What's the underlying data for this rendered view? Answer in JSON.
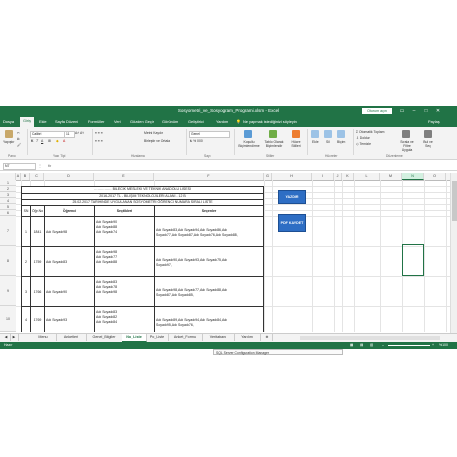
{
  "window": {
    "title": "Sosyometri_ve_Sosyogram_Programi.xlsm - Excel",
    "sign_in": "Oturum açın"
  },
  "menu": {
    "items": [
      "Dosya",
      "Giriş",
      "Ekle",
      "Sayfa Düzeni",
      "Formüller",
      "Veri",
      "Gözden Geçir",
      "Görünüm",
      "Geliştirici",
      "Yardım"
    ],
    "tell_me": "Ne yapmak istediğinizi söyleyin",
    "share": "Paylaş"
  },
  "ribbon": {
    "paste": "Yapıştır",
    "font_name": "Calibri",
    "font_size": "11",
    "wrap_text": "Metni Kaydır",
    "merge_center": "Birleştir ve Ortala",
    "number_format": "Genel",
    "cond_format": "Koşullu Biçimlendirme",
    "format_table": "Tablo Olarak Biçimlendir",
    "cell_styles": "Hücre Stilleri",
    "insert": "Ekle",
    "delete": "Sil",
    "format": "Biçim",
    "autosum": "Otomatik Toplam",
    "fill": "Doldur",
    "clear": "Temizle",
    "sort_filter": "Sırala ve Filtre Uygula",
    "find_select": "Bul ve Seç",
    "groups": [
      "Pano",
      "Yazı Tipi",
      "Hizalama",
      "Sayı",
      "Stiller",
      "Hücreler",
      "Düzenleme"
    ]
  },
  "formula_bar": {
    "name_box": "N7",
    "fx": "fx",
    "value": ""
  },
  "columns": [
    "A",
    "B",
    "C",
    "D",
    "E",
    "F",
    "G",
    "H",
    "I",
    "J",
    "K",
    "L",
    "M",
    "N",
    "O"
  ],
  "rows": [
    "1",
    "2",
    "3",
    "4",
    "5",
    "6",
    "7",
    "8",
    "9",
    "10"
  ],
  "sheet": {
    "school": "…………… BİLECİK MESLEKİ VE TEKNİK ANADOLU LİSESİ",
    "class_line": "2016-2017   TL - BİLİŞİM TEKNOLOJİLERİ ALANI - 12 B",
    "date_line": "25.02.2017    TARİHİNDE UYGULANAN SOSYOMETRİ ÖĞRENCİ NUMARA SIRALI LİSTE",
    "headers": {
      "sn": "SN",
      "no": "Öğr.No",
      "student": "Öğrenci",
      "chosen": "Seçtikleri",
      "choosers": "Seçenler"
    },
    "records": [
      {
        "sn": "1",
        "no": "1841",
        "student": "Adı Soyadı98",
        "chosen": [
          "Adı Soyadı90",
          "Adı Soyadı88",
          "Adı Soyadı74"
        ],
        "choosers": [
          "Adı Soyadı83,Adı Soyadı94,Adı Soyadı86,Adı",
          "Soyadı77,Adı Soyadı87,Adı Soyadı76,Adı Soyadı88,"
        ]
      },
      {
        "sn": "2",
        "no": "1759",
        "student": "Adı Soyadı83",
        "chosen": [
          "Adı Soyadı98",
          "Adı Soyadı77",
          "Adı Soyadı88"
        ],
        "choosers": [
          "Adı Soyadı90,Adı Soyadı93,Adı Soyadı75,Adı",
          "Soyadı97,"
        ]
      },
      {
        "sn": "3",
        "no": "1766",
        "student": "Adı Soyadı90",
        "chosen": [
          "Adı Soyadı83",
          "Adı Soyadı78",
          "Adı Soyadı98"
        ],
        "choosers": [
          "Adı Soyadı98,Adı Soyadı77,Adı Soyadı88,Adı",
          "Soyadı87,Adı Soyadı85,"
        ]
      },
      {
        "sn": "4",
        "no": "1769",
        "student": "Adı Soyadı93",
        "chosen": [
          "Adı Soyadı83",
          "Adı Soyadı82",
          "Adı Soyadı84"
        ],
        "choosers": [
          "Adı Soyadı89,Adı Soyadı94,Adı Soyadı84,Adı",
          "Soyadı95,Adı Soyadı76,"
        ]
      }
    ],
    "print_button": "YAZDIR",
    "pdf_button": "PDF KAYDET"
  },
  "tabs": [
    "Menu",
    "Anketleri",
    "Genel_Bilgiler",
    "No_Liste",
    "Po_Liste",
    "Anket_Formu",
    "Veritabanı",
    "Yardım"
  ],
  "active_tab": "No_Liste",
  "status": {
    "mode": "Hazır",
    "zoom": "%100"
  },
  "taskbar": {
    "tooltip": "SQL Server Configuration Manager"
  },
  "colors": {
    "accent": "#217346",
    "button": "#2e6ec4"
  }
}
